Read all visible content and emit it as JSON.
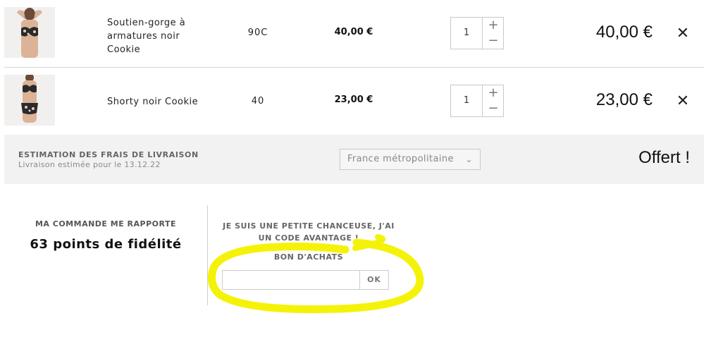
{
  "cart": {
    "items": [
      {
        "name": "Soutien-gorge à armatures noir Cookie",
        "size": "90C",
        "unit_price": "40,00 €",
        "quantity": "1",
        "total": "40,00 €",
        "image_icon": "bra-product-image"
      },
      {
        "name": "Shorty noir Cookie",
        "size": "40",
        "unit_price": "23,00 €",
        "quantity": "1",
        "total": "23,00 €",
        "image_icon": "lingerie-set-product-image"
      }
    ],
    "qty_plus": "+",
    "qty_minus": "−",
    "remove_glyph": "✕"
  },
  "shipping": {
    "title": "ESTIMATION DES FRAIS DE LIVRAISON",
    "date": "Livraison estimée pour le 13.12.22",
    "country_selected": "France métropolitaine",
    "cost": "Offert !"
  },
  "loyalty": {
    "title": "MA COMMANDE ME RAPPORTE",
    "points": "63 points de fidélité"
  },
  "promo": {
    "title": "JE SUIS UNE PETITE CHANCEUSE, J'AI UN CODE AVANTAGE !",
    "voucher_label": "BON D'ACHATS",
    "voucher_value": "",
    "ok_label": "OK"
  },
  "colors": {
    "highlight": "#f5f20a",
    "shipping_bg": "#f2f2f2"
  }
}
